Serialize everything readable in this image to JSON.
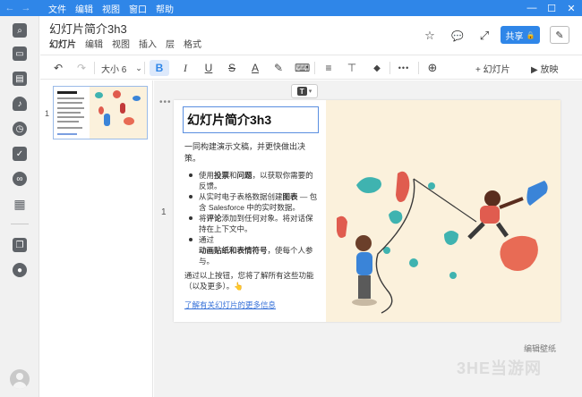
{
  "titlebar": {
    "menus": [
      "文件",
      "编辑",
      "视图",
      "窗口",
      "帮助"
    ],
    "back_glyph": "←",
    "forward_glyph": "→",
    "minimize_glyph": "—",
    "maximize_glyph": "☐",
    "close_glyph": "✕"
  },
  "document": {
    "title": "幻灯片简介3h3",
    "menus": [
      "幻灯片",
      "编辑",
      "视图",
      "插入",
      "层",
      "格式"
    ]
  },
  "header": {
    "share_label": "共享",
    "lock_glyph": "🔒",
    "star_glyph": "☆",
    "comment_glyph": "💬",
    "expand_glyph": "⤢",
    "edit_glyph": "✎"
  },
  "toolbar": {
    "undo": "↶",
    "redo": "↷",
    "font_size": "大小 6",
    "bold": "B",
    "italic": "I",
    "underline": "U",
    "strike": "S",
    "text_color": "A",
    "highlighter": "✎",
    "code": "⌨",
    "align": "≡",
    "valign": "⊤",
    "fill": "◆",
    "more": "•••",
    "zoom": "⊕",
    "add_slide": "+ 幻灯片",
    "play": "▶ 放映"
  },
  "thumbnails": [
    {
      "number": "1"
    }
  ],
  "slide": {
    "number": "1",
    "title": "幻灯片简介3h3",
    "desc": "一同构建演示文稿，并更快做出决策。",
    "bullets": [
      {
        "pre": "使用",
        "b1": "投票",
        "mid": "和",
        "b2": "问题",
        "post": "，以获取你需要的反馈。"
      },
      {
        "pre": "从实时电子表格数据创建",
        "b1": "图表",
        "mid": "",
        "b2": "",
        "post": " — 包含 Salesforce 中的实时数据。"
      },
      {
        "pre": "将",
        "b1": "评论",
        "mid": "",
        "b2": "",
        "post": "添加到任何对象。将对话保持在上下文中。"
      },
      {
        "pre": "通过",
        "b1": "动画贴纸和表情符号",
        "mid": "",
        "b2": "",
        "post": "，使每个人参与。"
      }
    ],
    "closing": "通过以上按钮，您将了解所有这些功能（以及更多）。",
    "closing_emoji": "👆",
    "link": "了解有关幻灯片的更多信息"
  },
  "bg_label": "编辑壁纸",
  "insert_glyph": "T",
  "insert_caret": "▾",
  "more_dots": "•••",
  "watermark": "3HE当游网",
  "sidebar_icons": [
    "search-icon",
    "window-icon",
    "inbox-icon",
    "bell-icon",
    "clock-icon",
    "check-icon",
    "link-icon",
    "apps-icon",
    "files-icon",
    "chat-icon"
  ],
  "colors": {
    "accent": "#2f86e8",
    "slide_bg": "#fbf1dc",
    "link": "#3570d8"
  }
}
